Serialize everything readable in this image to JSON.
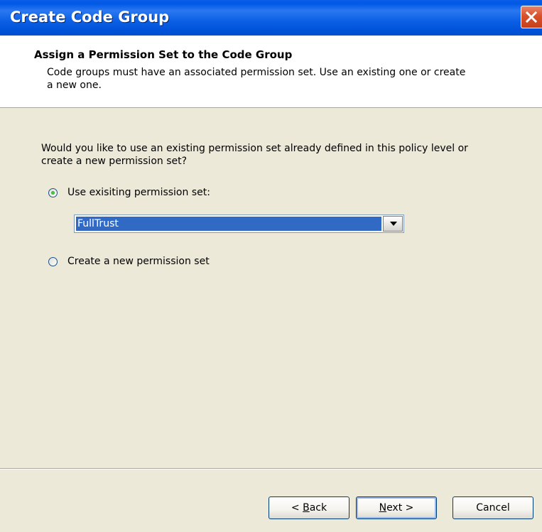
{
  "window": {
    "title": "Create Code Group",
    "close_glyph": "✕"
  },
  "header": {
    "title": "Assign a Permission Set to the Code Group",
    "description": "Code groups must have an associated permission set. Use an existing one or create a new one."
  },
  "body": {
    "question": "Would you like to use an existing permission set already defined in this policy level or create a new permission set?",
    "option_existing": {
      "label": "Use exisiting permission set:",
      "checked": true
    },
    "permission_select": {
      "value": "FullTrust"
    },
    "option_new": {
      "label": "Create a new permission set",
      "checked": false
    }
  },
  "buttons": {
    "back": {
      "prefix": "< ",
      "mnemonic": "B",
      "rest": "ack"
    },
    "next": {
      "mnemonic": "N",
      "rest": "ext",
      "suffix": " >"
    },
    "cancel": "Cancel"
  },
  "icons": {
    "close": "close-icon",
    "dropdown": "chevron-down-icon"
  }
}
